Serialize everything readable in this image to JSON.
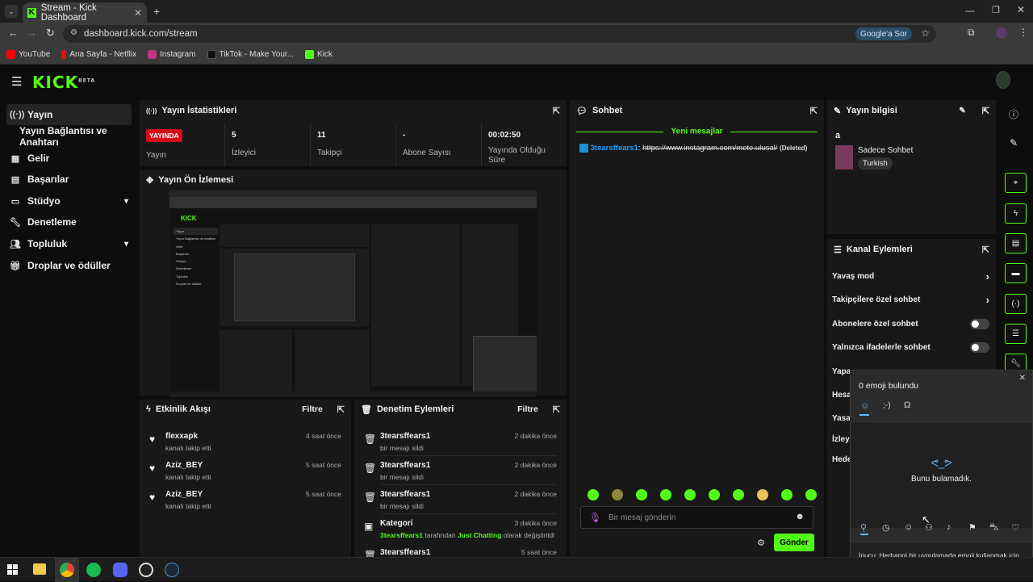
{
  "browser": {
    "tab_title": "Stream - Kick Dashboard",
    "url": "dashboard.kick.com/stream",
    "ask_google": "Google'a Sor",
    "bookmarks": [
      "YouTube",
      "Ana Sayfa - Netflix",
      "Instagram",
      "TikTok - Make Your...",
      "Kick"
    ]
  },
  "brand": {
    "logo": "KICK",
    "beta": "BETA",
    "accent": "#53fc18"
  },
  "sidebar": {
    "items": [
      {
        "label": "Yayın",
        "icon": "broadcast-icon"
      },
      {
        "label": "Yayın Bağlantısı ve Anahtarı",
        "icon": ""
      },
      {
        "label": "Gelir",
        "icon": "revenue-icon"
      },
      {
        "label": "Başarılar",
        "icon": "achievements-icon"
      },
      {
        "label": "Stüdyo",
        "icon": "studio-icon"
      },
      {
        "label": "Denetleme",
        "icon": "wrench-icon"
      },
      {
        "label": "Topluluk",
        "icon": "community-icon"
      },
      {
        "label": "Droplar ve ödüller",
        "icon": "drops-icon"
      }
    ]
  },
  "stats": {
    "title": "Yayın İstatistikleri",
    "live_badge": "YAYINDA",
    "items": [
      {
        "value": "",
        "label": "Yayın"
      },
      {
        "value": "5",
        "label": "İzleyici"
      },
      {
        "value": "11",
        "label": "Takipçi"
      },
      {
        "value": "-",
        "label": "Abone Sayısı"
      },
      {
        "value": "00:02:50",
        "label": "Yayında Olduğu Süre"
      }
    ]
  },
  "preview": {
    "title": "Yayın Ön İzlemesi"
  },
  "activity": {
    "title": "Etkinlik Akışı",
    "filter": "Filtre",
    "rows": [
      {
        "name": "flexxapk",
        "sub": "kanalı takip etti",
        "time": "4 saat önce"
      },
      {
        "name": "Aziz_BEY",
        "sub": "kanalı takip etti",
        "time": "5 saat önce"
      },
      {
        "name": "Aziz_BEY",
        "sub": "kanalı takip etti",
        "time": "5 saat önce"
      }
    ]
  },
  "moderation": {
    "title": "Denetim Eylemleri",
    "filter": "Filtre",
    "rows": [
      {
        "name": "3tearsffears1",
        "sub": "bir mesajı sildi",
        "time": "2 dakika önce"
      },
      {
        "name": "3tearsffears1",
        "sub": "bir mesajı sildi",
        "time": "2 dakika önce"
      },
      {
        "name": "3tearsffears1",
        "sub": "bir mesajı sildi",
        "time": "2 dakika önce"
      },
      {
        "name": "Kategori",
        "sub_user": "3tearsffears1",
        "sub_mid": " tarafından ",
        "sub_cat": "Just Chatting",
        "sub_end": " olarak değiştirildi",
        "time": "3 dakika önce"
      },
      {
        "name": "3tearsffears1",
        "sub": "",
        "time": "5 saat önce"
      }
    ]
  },
  "chat": {
    "title": "Sohbet",
    "new_messages": "Yeni mesajlar",
    "message_user": "3tearsffears1",
    "message_colon": ":",
    "message_link": "https://www.instagram.com/mete.ulusal/",
    "message_deleted": "(Deleted)",
    "input_placeholder": "Bir mesaj gönderin",
    "send_label": "Gönder"
  },
  "stream_info": {
    "title": "Yayın bilgisi",
    "stream_title": "a",
    "category": "Sadece Sohbet",
    "language": "Turkish"
  },
  "channel_actions": {
    "title": "Kanal Eylemleri",
    "items": [
      {
        "label": "Yavaş mod",
        "control": "chevron"
      },
      {
        "label": "Takipçilere özel sohbet",
        "control": "chevron"
      },
      {
        "label": "Abonelere özel sohbet",
        "control": "toggle"
      },
      {
        "label": "Yalnızca ifadelerle sohbet",
        "control": "toggle"
      },
      {
        "label": "Yapa",
        "control": ""
      },
      {
        "label": "Hesa",
        "control": ""
      },
      {
        "label": "Yasa",
        "control": ""
      },
      {
        "label": "İzley",
        "control": ""
      },
      {
        "label": "Hede",
        "control": ""
      }
    ]
  },
  "emoji_panel": {
    "count_text": "0 emoji bulundu",
    "kaomoji": "ᕙ_ᕗ",
    "not_found": "Bunu bulamadık.",
    "tip": "İpucu: Herhangi bir uygulamada emoji kullanmak için  + nokta (.) tuşlarına basın"
  },
  "preview_thumbnail": {
    "mini_labels": [
      "Yayın",
      "Yayın Bağlantısı ve Anahtar",
      "Gelir",
      "Başarılar",
      "Stüdyo",
      "Denetleme",
      "Topluluk",
      "Droplar ve ödüller"
    ]
  }
}
